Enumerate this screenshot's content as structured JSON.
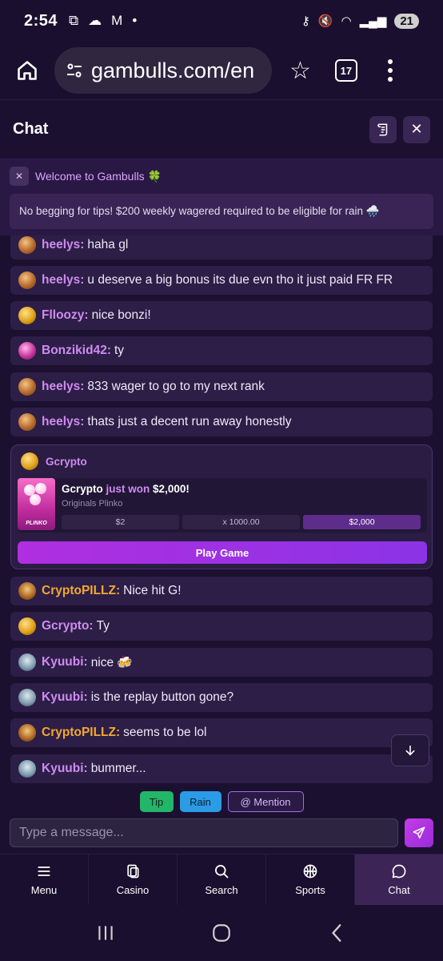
{
  "statusbar": {
    "time": "2:54",
    "battery": "21"
  },
  "browser": {
    "url": "gambulls.com/en",
    "tab_count": "17"
  },
  "chat": {
    "title": "Chat",
    "welcome": "Welcome to Gambulls 🍀",
    "notice": "No begging for tips! $200 weekly wagered required to be eligible for rain 🌧️",
    "messages": [
      {
        "user": "heelys:",
        "text": "haha gl",
        "avatar": "bronze",
        "gold": false
      },
      {
        "user": "heelys:",
        "text": "u deserve a big bonus its due evn tho it just paid FR FR",
        "avatar": "bronze",
        "gold": false
      },
      {
        "user": "Flloozy:",
        "text": "nice bonzi!",
        "avatar": "gold",
        "gold": false
      },
      {
        "user": "Bonzikid42:",
        "text": "ty",
        "avatar": "pink",
        "gold": false
      },
      {
        "user": "heelys:",
        "text": "833 wager to go to my next rank",
        "avatar": "bronze",
        "gold": false
      },
      {
        "user": "heelys:",
        "text": "thats just a decent run away honestly",
        "avatar": "bronze",
        "gold": false
      }
    ],
    "win": {
      "user": "Gcrypto",
      "title_user": "Gcrypto",
      "title_mid": "just won",
      "amount": "$2,000!",
      "game": "Originals Plinko",
      "bet": "$2",
      "multiplier": "x 1000.00",
      "payout": "$2,000",
      "thumb_label": "PLINKO",
      "button": "Play Game"
    },
    "messages_after": [
      {
        "user": "CryptoPILLZ:",
        "text": "Nice hit G!",
        "avatar": "bull",
        "gold": true
      },
      {
        "user": "Gcrypto:",
        "text": "Ty",
        "avatar": "gold",
        "gold": false
      },
      {
        "user": "Kyuubi:",
        "text": "nice 🍻",
        "avatar": "silver",
        "gold": false
      },
      {
        "user": "Kyuubi:",
        "text": "is the replay button gone?",
        "avatar": "silver",
        "gold": false
      },
      {
        "user": "CryptoPILLZ:",
        "text": "seems to be lol",
        "avatar": "bull",
        "gold": true
      },
      {
        "user": "Kyuubi:",
        "text": "bummer...",
        "avatar": "silver",
        "gold": false
      }
    ],
    "chips": {
      "tip": "Tip",
      "rain": "Rain",
      "mention": "@ Mention"
    },
    "input_placeholder": "Type a message..."
  },
  "nav": {
    "menu": "Menu",
    "casino": "Casino",
    "search": "Search",
    "sports": "Sports",
    "chat": "Chat"
  },
  "colors": {
    "accent": "#cf8bf0",
    "gold_user": "#f2a832",
    "background": "#1b1030"
  }
}
